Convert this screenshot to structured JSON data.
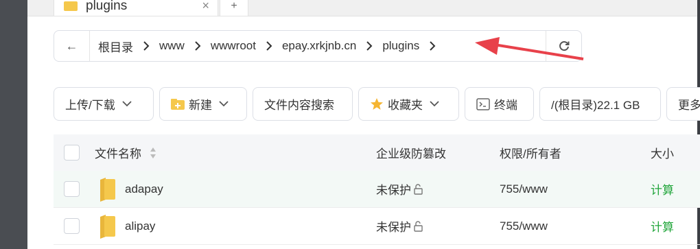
{
  "tabs": {
    "active_label": "plugins",
    "close_glyph": "×",
    "add_glyph": "+"
  },
  "pathbar": {
    "back_glyph": "←",
    "crumbs": [
      "根目录",
      "www",
      "wwwroot",
      "epay.xrkjnb.cn",
      "plugins"
    ],
    "refresh_icon": "refresh-icon"
  },
  "toolbar": {
    "upload_download": "上传/下载",
    "new": "新建",
    "content_search": "文件内容搜索",
    "favorites": "收藏夹",
    "terminal": "终端",
    "disk": "/(根目录)22.1 GB",
    "more": "更多"
  },
  "table": {
    "headers": {
      "name": "文件名称",
      "protection": "企业级防篡改",
      "permission": "权限/所有者",
      "size": "大小"
    },
    "rows": [
      {
        "name": "adapay",
        "protection": "未保护",
        "permission": "755/www",
        "size": "计算"
      },
      {
        "name": "alipay",
        "protection": "未保护",
        "permission": "755/www",
        "size": "计算"
      }
    ]
  },
  "colors": {
    "accent_green": "#20a53a",
    "arrow_red": "#e8414a",
    "folder_yellow": "#f5c84c"
  }
}
